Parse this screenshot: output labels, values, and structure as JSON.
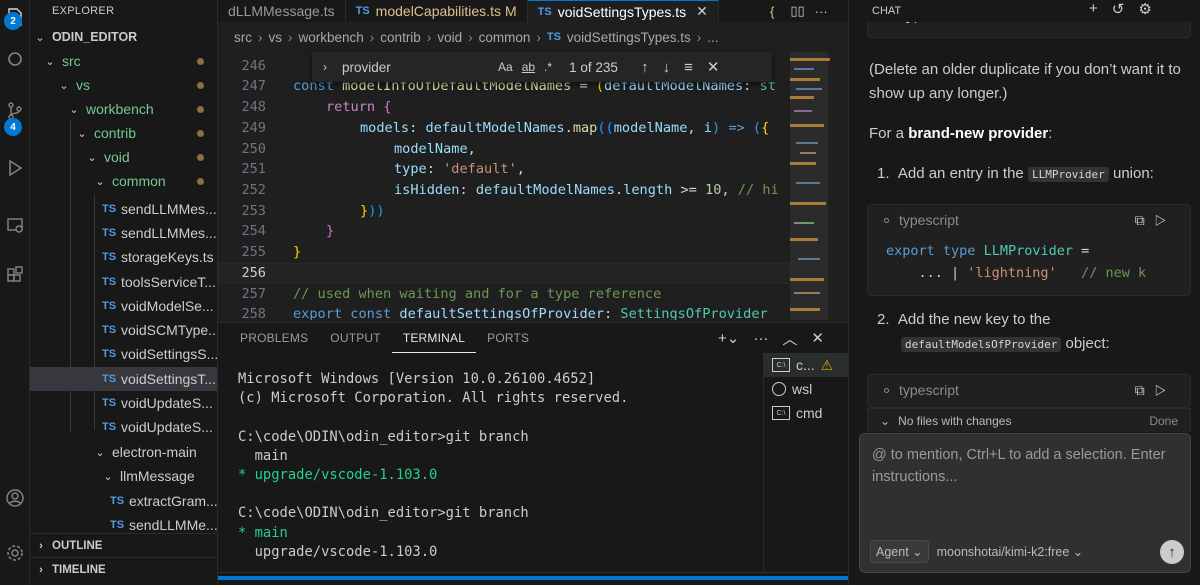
{
  "activity_bar": {
    "explorer_badge": "2",
    "scm_badge": "4"
  },
  "explorer": {
    "title": "EXPLORER",
    "root": "ODIN_EDITOR",
    "tree": [
      {
        "label": "src",
        "kind": "folder"
      },
      {
        "label": "vs",
        "kind": "folder"
      },
      {
        "label": "workbench",
        "kind": "folder"
      },
      {
        "label": "contrib",
        "kind": "folder"
      },
      {
        "label": "void",
        "kind": "folder"
      },
      {
        "label": "common",
        "kind": "folder"
      },
      {
        "label": "sendLLMMes...",
        "kind": "file"
      },
      {
        "label": "sendLLMMes...",
        "kind": "file"
      },
      {
        "label": "storageKeys.ts",
        "kind": "file"
      },
      {
        "label": "toolsServiceT...",
        "kind": "file"
      },
      {
        "label": "voidModelSe...",
        "kind": "file"
      },
      {
        "label": "voidSCMType...",
        "kind": "file"
      },
      {
        "label": "voidSettingsS...",
        "kind": "file"
      },
      {
        "label": "voidSettingsT...",
        "kind": "file"
      },
      {
        "label": "voidUpdateS...",
        "kind": "file"
      },
      {
        "label": "voidUpdateS...",
        "kind": "file"
      },
      {
        "label": "electron-main",
        "kind": "folder"
      },
      {
        "label": "llmMessage",
        "kind": "folder"
      },
      {
        "label": "extractGram...",
        "kind": "file"
      },
      {
        "label": "sendLLMMe...",
        "kind": "file"
      }
    ],
    "outline_label": "OUTLINE",
    "timeline_label": "TIMELINE"
  },
  "tabs": [
    {
      "label": "dLLMMessage.ts",
      "icon": "",
      "active": false,
      "modified": false
    },
    {
      "label": "modelCapabilities.ts",
      "icon": "TS",
      "active": false,
      "modified": true,
      "badge": "M"
    },
    {
      "label": "voidSettingsTypes.ts",
      "icon": "TS",
      "active": true,
      "modified": false
    }
  ],
  "tab_overflow_label": "{",
  "breadcrumb": [
    "src",
    "vs",
    "workbench",
    "contrib",
    "void",
    "common",
    "voidSettingsTypes.ts",
    "..."
  ],
  "find_widget": {
    "query": "provider",
    "options": [
      "Aa",
      "ab",
      ".*"
    ],
    "result_count": "1 of 235"
  },
  "code": {
    "lines": [
      "246",
      "247",
      "248",
      "249",
      "250",
      "251",
      "252",
      "253",
      "254",
      "255",
      "256",
      "257",
      "258"
    ],
    "current_line": "256"
  },
  "panel": {
    "tabs": [
      "PROBLEMS",
      "OUTPUT",
      "TERMINAL",
      "PORTS"
    ],
    "active_tab": "TERMINAL",
    "terminal_lines": [
      "Microsoft Windows [Version 10.0.26100.4652]",
      "(c) Microsoft Corporation. All rights reserved.",
      "",
      "C:\\code\\ODIN\\odin_editor>git branch",
      "  main",
      "* upgrade/vscode-1.103.0",
      "",
      "C:\\code\\ODIN\\odin_editor>git branch",
      "* main",
      "  upgrade/vscode-1.103.0"
    ],
    "terminals": [
      {
        "label": "c...",
        "warning": true
      },
      {
        "label": "wsl",
        "warning": false
      },
      {
        "label": "cmd",
        "warning": false
      }
    ]
  },
  "chat": {
    "title": "CHAT",
    "top_code_tail": "],",
    "para1": "(Delete an older duplicate if you don’t want it to show up any longer.)",
    "para2_prefix": "For a ",
    "para2_bold": "brand-new provider",
    "para2_suffix": ":",
    "step1_num": "1.",
    "step1_prefix": "Add an entry in the ",
    "step1_chip": "LLMProvider",
    "step1_suffix": " union:",
    "card1_lang": "typescript",
    "card1_line1": "export type LLMProvider =",
    "card1_line2": "    ... | 'lightning'   // new k",
    "step2_num": "2.",
    "step2_prefix": "Add the new key to the",
    "step2_chip": "defaultModelsOfProvider",
    "step2_suffix": " object:",
    "card2_lang": "typescript",
    "files_label": "No files with changes",
    "files_done": "Done",
    "input_placeholder": "@ to mention, Ctrl+L to add a selection. Enter instructions...",
    "mode": "Agent",
    "model": "moonshotai/kimi-k2:free"
  }
}
